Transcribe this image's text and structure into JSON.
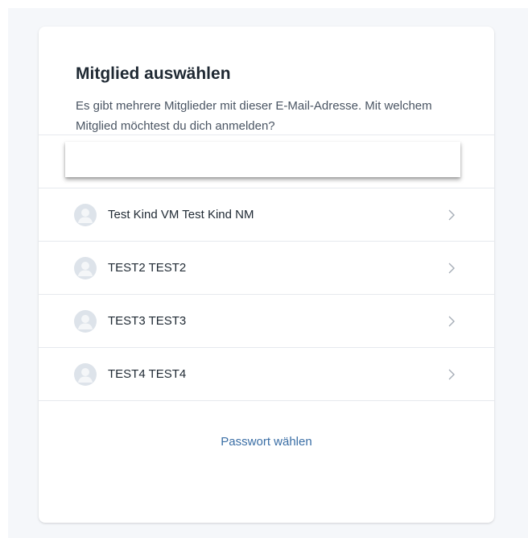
{
  "dialog": {
    "title": "Mitglied auswählen",
    "description": "Es gibt mehrere Mitglieder mit dieser E-Mail-Adresse. Mit welchem Mitglied möchtest du dich anmelden?"
  },
  "search": {
    "value": "",
    "placeholder": ""
  },
  "members": [
    {
      "name": "Test Kind VM Test Kind NM",
      "icon": "user-avatar-icon",
      "action_icon": "chevron-right-icon"
    },
    {
      "name": "TEST2 TEST2",
      "icon": "user-avatar-icon",
      "action_icon": "chevron-right-icon"
    },
    {
      "name": "TEST3 TEST3",
      "icon": "user-avatar-icon",
      "action_icon": "chevron-right-icon"
    },
    {
      "name": "TEST4 TEST4",
      "icon": "user-avatar-icon",
      "action_icon": "chevron-right-icon"
    }
  ],
  "footer": {
    "password_link": "Passwort wählen"
  },
  "colors": {
    "link": "#3a6ea5",
    "background": "#f5f7fa",
    "card": "#ffffff",
    "divider": "#e6e9ee"
  }
}
